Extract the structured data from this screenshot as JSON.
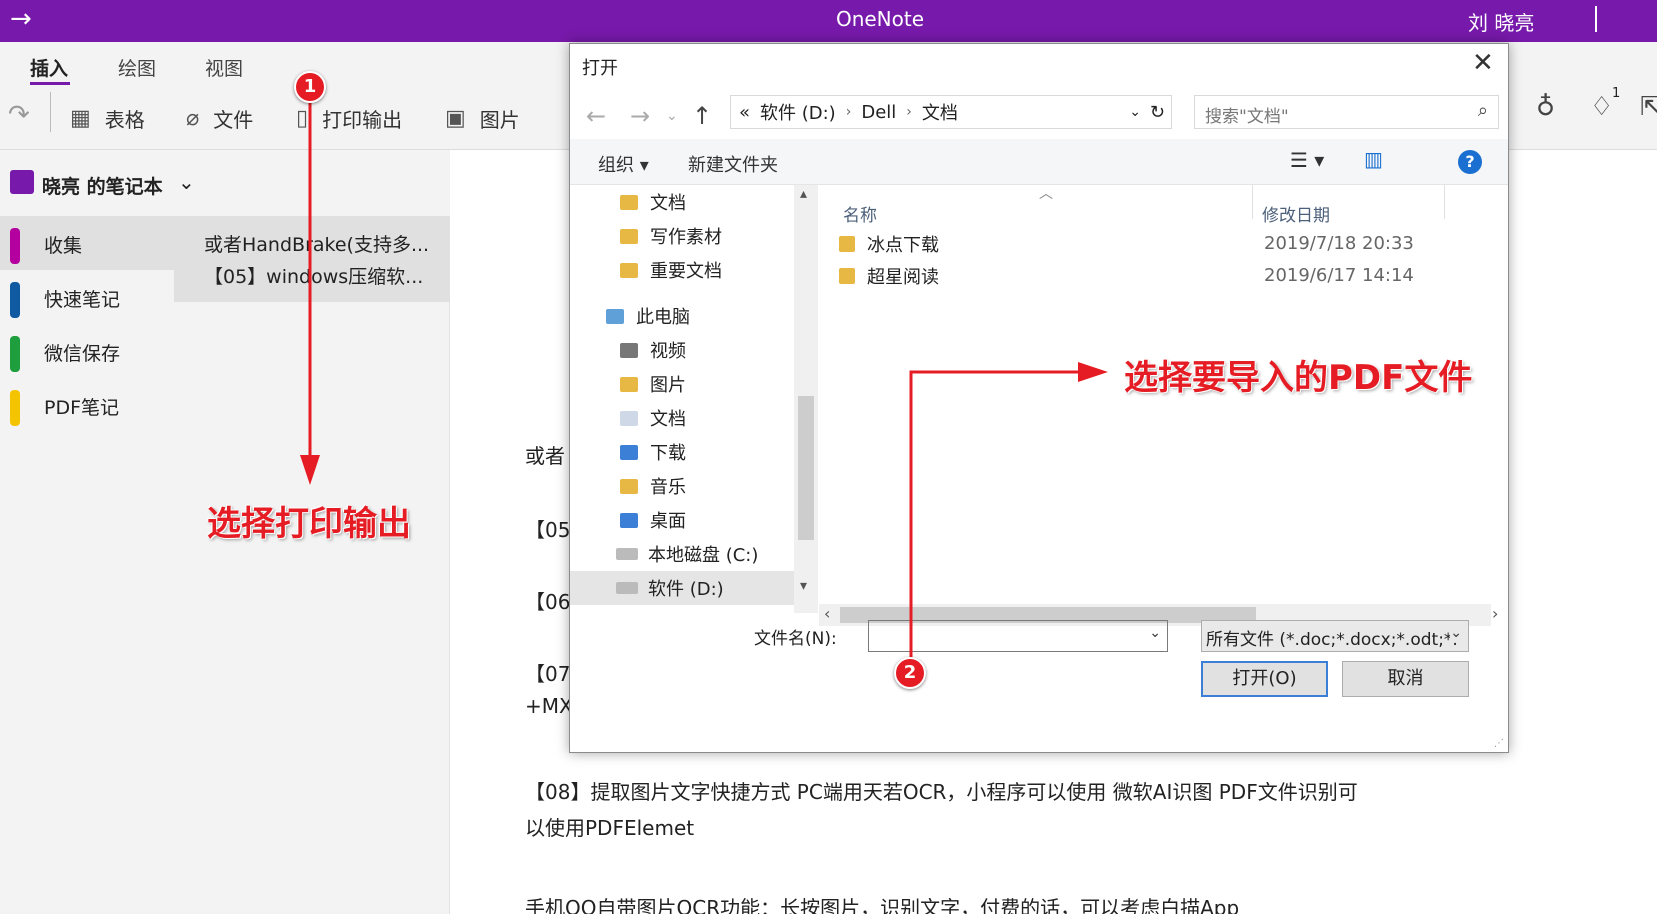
{
  "titlebar": {
    "app_name": "OneNote",
    "user": "刘 晓亮"
  },
  "ribbon": {
    "tabs": [
      "插入",
      "绘图",
      "视图"
    ],
    "tools": {
      "table": "表格",
      "file": "文件",
      "printout": "打印输出",
      "picture": "图片"
    }
  },
  "notebook": {
    "name": "晓亮 的笔记本",
    "sections": [
      {
        "label": "收集",
        "color": "#b4009e"
      },
      {
        "label": "快速笔记",
        "color": "#0f5aa0"
      },
      {
        "label": "微信保存",
        "color": "#1e9e3c"
      },
      {
        "label": "PDF笔记",
        "color": "#f5c400"
      }
    ],
    "pages": [
      "或者HandBrake(支持多...",
      "【05】windows压缩软..."
    ]
  },
  "note": {
    "lines": [
      "或者",
      "【05",
      "【06",
      "【07",
      "+MXI"
    ],
    "para1_line1": "【08】提取图片文字快捷方式 PC端用天若OCR，小程序可以使用 微软AI识图 PDF文件识别可",
    "para1_line2": "以使用PDFElemet",
    "para2": "手机QQ自带图片OCR功能：长按图片，识别文字，付费的话，可以考虑白描App"
  },
  "dialog": {
    "title": "打开",
    "breadcrumb": [
      "«",
      "软件 (D:)",
      "Dell",
      "文档"
    ],
    "search_placeholder": "搜索\"文档\"",
    "organize": "组织 ▾",
    "new_folder": "新建文件夹",
    "nav_items": [
      {
        "label": "文档",
        "type": "folder"
      },
      {
        "label": "写作素材",
        "type": "folder"
      },
      {
        "label": "重要文档",
        "type": "folder"
      },
      {
        "label": "此电脑",
        "type": "pc"
      },
      {
        "label": "视频",
        "type": "folder"
      },
      {
        "label": "图片",
        "type": "folder"
      },
      {
        "label": "文档",
        "type": "folder"
      },
      {
        "label": "下载",
        "type": "folder"
      },
      {
        "label": "音乐",
        "type": "folder"
      },
      {
        "label": "桌面",
        "type": "folder"
      },
      {
        "label": "本地磁盘 (C:)",
        "type": "drive"
      },
      {
        "label": "软件 (D:)",
        "type": "drive",
        "selected": true
      }
    ],
    "columns": {
      "name": "名称",
      "modified": "修改日期"
    },
    "files": [
      {
        "name": "冰点下载",
        "modified": "2019/7/18 20:33"
      },
      {
        "name": "超星阅读",
        "modified": "2019/6/17 14:14"
      }
    ],
    "filename_label": "文件名(N):",
    "filename_value": "",
    "filetype": "所有文件 (*.doc;*.docx;*.odt;*.",
    "open_button": "打开(O)",
    "cancel_button": "取消"
  },
  "annotations": {
    "step1_badge": "1",
    "step1_text": "选择打印输出",
    "step2_badge": "2",
    "step2_text": "选择要导入的PDF文件",
    "color": "#e51c23"
  },
  "notification_count": "1"
}
